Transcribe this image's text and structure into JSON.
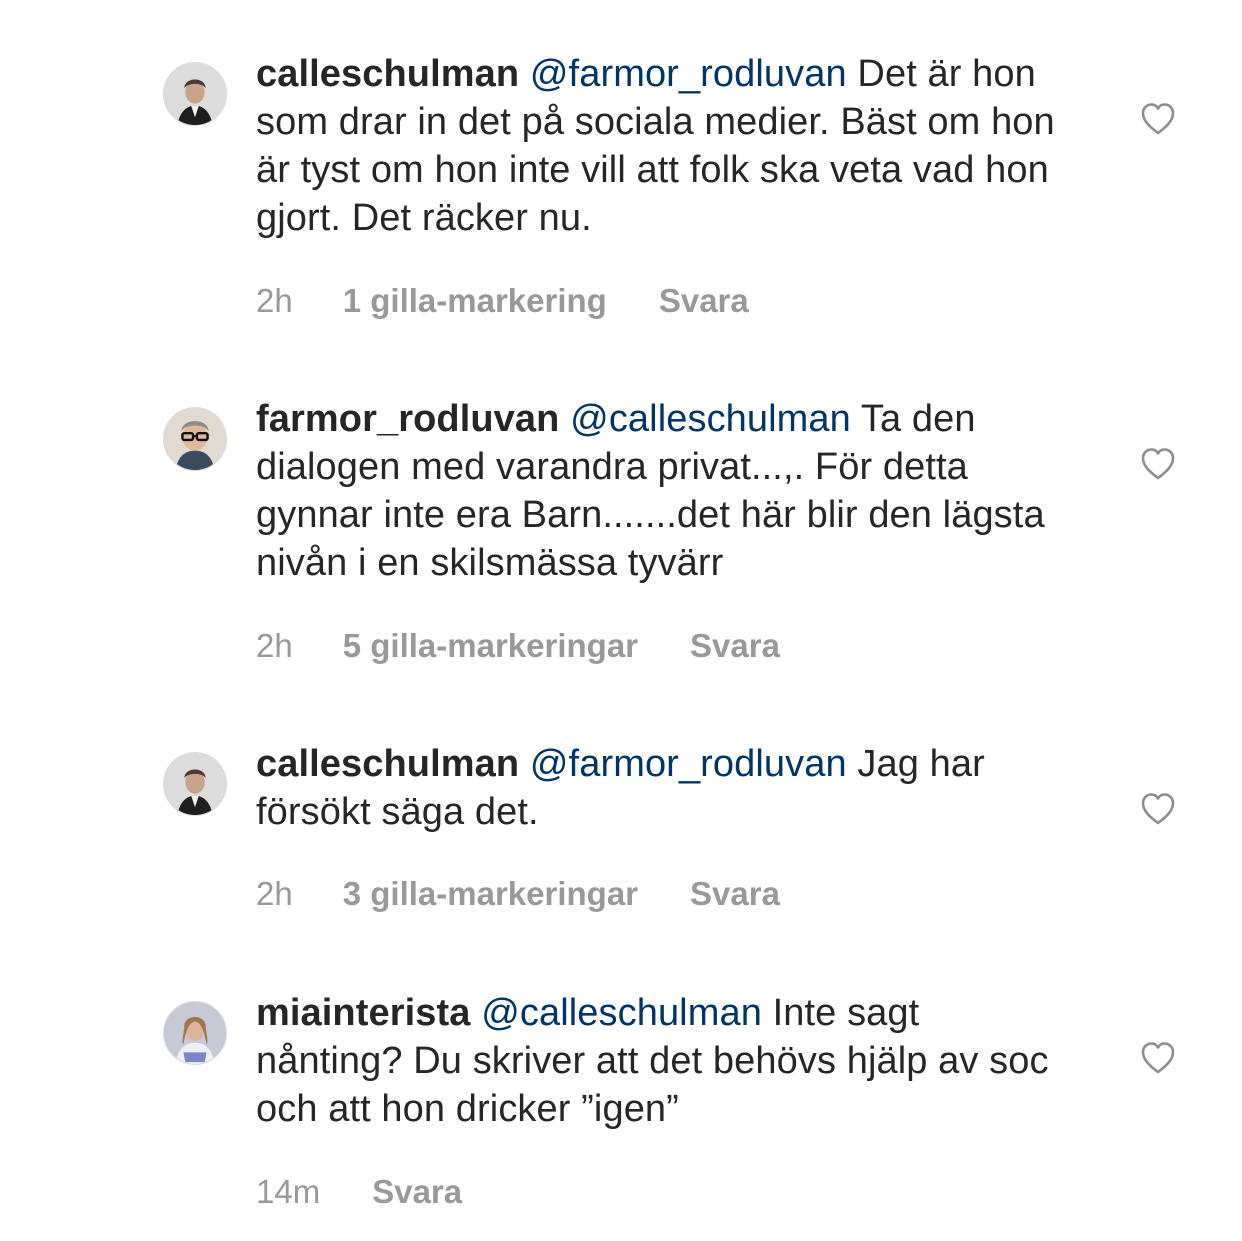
{
  "comments": [
    {
      "username": "calleschulman",
      "mention": "@farmor_rodluvan",
      "text": "Det är hon som drar in det på sociala medier. Bäst om hon är tyst om hon inte vill att folk ska veta vad hon gjort. Det räcker nu.",
      "time": "2h",
      "likes": "1 gilla-markering",
      "reply": "Svara",
      "avatar_icon": "profile-photo-man-in-suit",
      "like_icon": "heart-outline-icon"
    },
    {
      "username": "farmor_rodluvan",
      "mention": "@calleschulman",
      "text": "Ta den dialogen med varandra privat...,. För detta gynnar inte era Barn.......det här blir den lägsta nivån i en skilsmässa tyvärr",
      "time": "2h",
      "likes": "5 gilla-markeringar",
      "reply": "Svara",
      "avatar_icon": "profile-photo-person-with-glasses",
      "like_icon": "heart-outline-icon"
    },
    {
      "username": "calleschulman",
      "mention": "@farmor_rodluvan",
      "text": "Jag har försökt säga det.",
      "time": "2h",
      "likes": "3 gilla-markeringar",
      "reply": "Svara",
      "avatar_icon": "profile-photo-man-in-suit",
      "like_icon": "heart-outline-icon"
    },
    {
      "username": "miainterista",
      "mention": "@calleschulman",
      "text": "Inte sagt nånting? Du skriver att det behövs hjälp av soc och att hon dricker ”igen”",
      "time": "14m",
      "likes": "",
      "reply": "Svara",
      "avatar_icon": "profile-photo-woman",
      "like_icon": "heart-outline-icon"
    }
  ],
  "colors": {
    "username": "#262626",
    "mention": "#003569",
    "meta": "#999999",
    "heart_stroke": "#8e8e8e"
  }
}
